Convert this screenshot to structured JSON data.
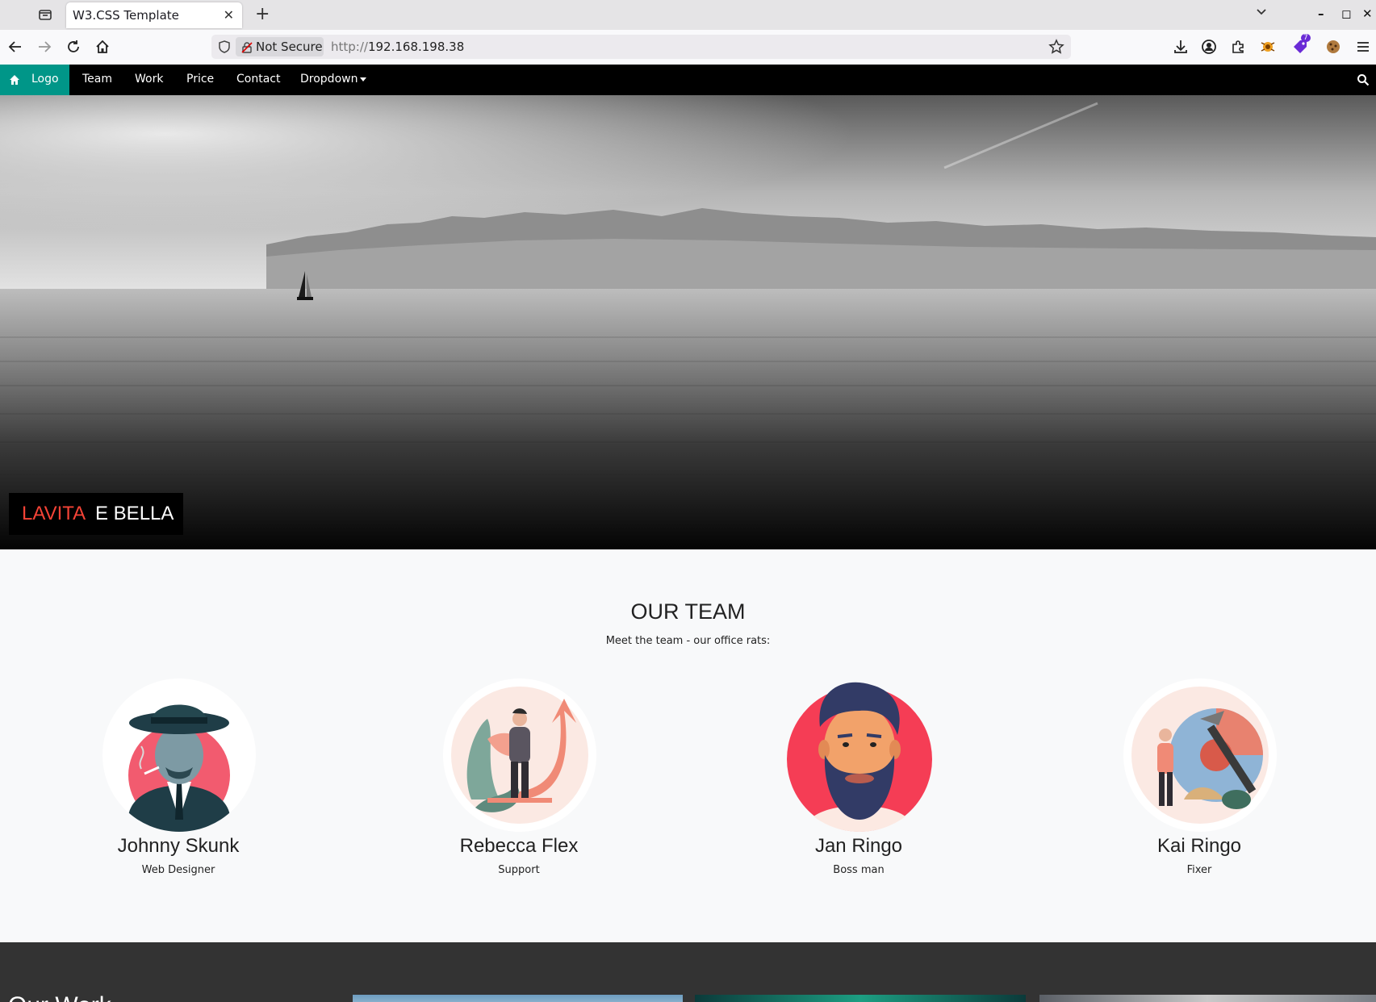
{
  "browser": {
    "tab_title": "W3.CSS Template",
    "security_label": "Not Secure",
    "url_scheme": "http://",
    "url_host": "192.168.198.38",
    "extension_badge": "7"
  },
  "nav": {
    "logo": "Logo",
    "links": [
      "Team",
      "Work",
      "Price",
      "Contact"
    ],
    "dropdown": "Dropdown"
  },
  "hero": {
    "title_red": "LAVITA",
    "title_white": "E BELLA"
  },
  "team": {
    "heading": "OUR TEAM",
    "subtitle": "Meet the team - our office rats:",
    "members": [
      {
        "name": "Johnny Skunk",
        "role": "Web Designer"
      },
      {
        "name": "Rebecca Flex",
        "role": "Support"
      },
      {
        "name": "Jan Ringo",
        "role": "Boss man"
      },
      {
        "name": "Kai Ringo",
        "role": "Fixer"
      }
    ]
  },
  "work": {
    "heading": "Our Work"
  },
  "colors": {
    "accent_teal": "#009688",
    "accent_red": "#f44336",
    "nav_bg": "#000000",
    "dark_section": "#333333"
  }
}
